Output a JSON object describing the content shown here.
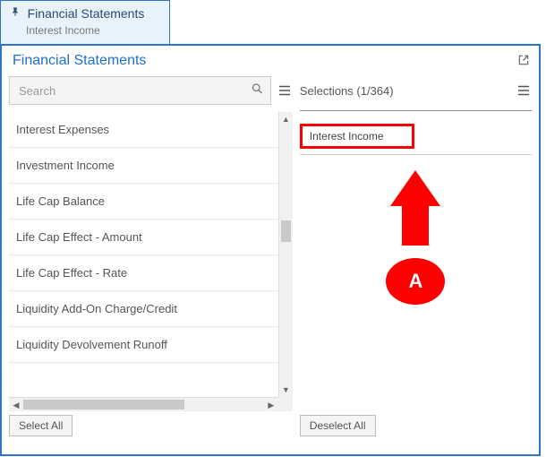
{
  "tab": {
    "title": "Financial Statements",
    "subtitle": "Interest Income"
  },
  "panel": {
    "title": "Financial Statements"
  },
  "search": {
    "placeholder": "Search",
    "value": ""
  },
  "available_items": [
    "Interest Expenses",
    "Investment Income",
    "Life Cap Balance",
    "Life Cap Effect - Amount",
    "Life Cap Effect - Rate",
    "Liquidity Add-On Charge/Credit",
    "Liquidity Devolvement Runoff"
  ],
  "selections": {
    "label": "Selections (1/364)",
    "items": [
      "Interest Income"
    ]
  },
  "buttons": {
    "select_all": "Select All",
    "deselect_all": "Deselect All"
  },
  "annotation": {
    "label": "A"
  }
}
